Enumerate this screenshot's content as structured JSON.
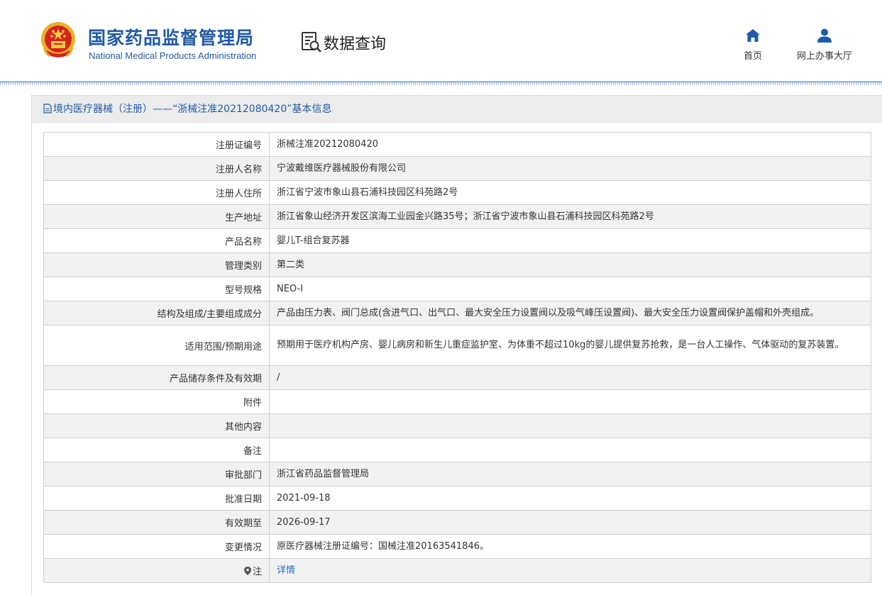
{
  "header": {
    "org_name_cn": "国家药品监督管理局",
    "org_name_en": "National Medical Products Administration",
    "section_title": "数据查询",
    "nav": [
      {
        "label": "首页",
        "icon": "home-icon"
      },
      {
        "label": "网上办事大厅",
        "icon": "user-icon"
      }
    ]
  },
  "panel": {
    "title": "境内医疗器械（注册）——“浙械注准20212080420”基本信息"
  },
  "colors": {
    "brand_blue": "#1f5aa6",
    "link_blue": "#1f6ec2",
    "row_alt": "#f2f2f2"
  },
  "rows": [
    {
      "label": "注册证编号",
      "value": "浙械注准20212080420"
    },
    {
      "label": "注册人名称",
      "value": "宁波戴维医疗器械股份有限公司"
    },
    {
      "label": "注册人住所",
      "value": "浙江省宁波市象山县石浦科技园区科苑路2号"
    },
    {
      "label": "生产地址",
      "value": "浙江省象山经济开发区滨海工业园金兴路35号；浙江省宁波市象山县石浦科技园区科苑路2号"
    },
    {
      "label": "产品名称",
      "value": "婴儿T-组合复苏器"
    },
    {
      "label": "管理类别",
      "value": "第二类"
    },
    {
      "label": "型号规格",
      "value": "NEO-Ⅰ"
    },
    {
      "label": "结构及组成/主要组成成分",
      "value": "产品由压力表、阀门总成(含进气口、出气口、最大安全压力设置阀以及吸气峰压设置阀)、最大安全压力设置阀保护盖帽和外壳组成。"
    },
    {
      "label": "适用范围/预期用途",
      "value": "预期用于医疗机构产房、婴儿病房和新生儿重症监护室、为体重不超过10kg的婴儿提供复苏抢救，是一台人工操作、气体驱动的复苏装置。"
    },
    {
      "label": "产品储存条件及有效期",
      "value": "/"
    },
    {
      "label": "附件",
      "value": ""
    },
    {
      "label": "其他内容",
      "value": ""
    },
    {
      "label": "备注",
      "value": ""
    },
    {
      "label": "审批部门",
      "value": "浙江省药品监督管理局"
    },
    {
      "label": "批准日期",
      "value": "2021-09-18"
    },
    {
      "label": "有效期至",
      "value": "2026-09-17"
    },
    {
      "label": "变更情况",
      "value": "原医疗器械注册证编号：国械注准20163541846。"
    },
    {
      "label": "注",
      "value": "详情"
    }
  ]
}
